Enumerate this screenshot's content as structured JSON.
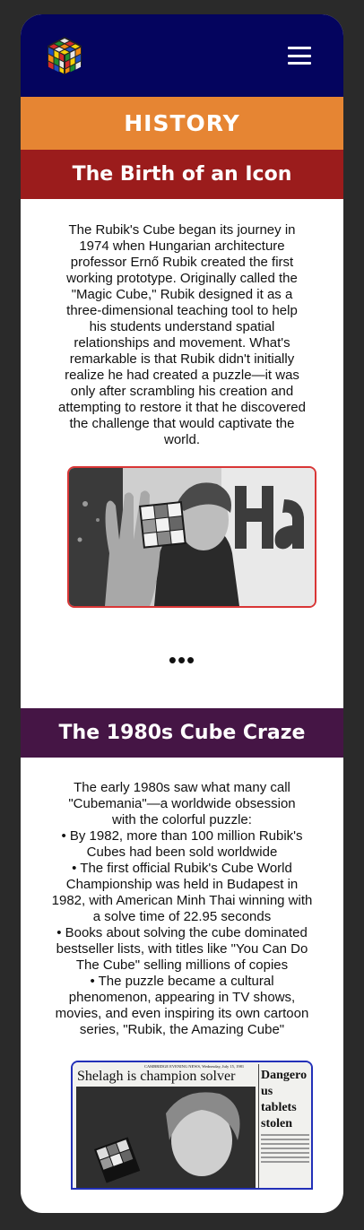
{
  "header": {
    "logo_icon": "rubiks-cube-logo",
    "menu_icon": "hamburger-menu-icon",
    "colors": {
      "background": "#04045e"
    }
  },
  "page": {
    "title": "HISTORY",
    "accent": "#e68533"
  },
  "sections": [
    {
      "heading": "The Birth of an Icon",
      "color": "#9b1c1c",
      "body": "The Rubik's Cube began its journey in 1974 when Hungarian architecture professor Ernő Rubik created the first working prototype. Originally called the \"Magic Cube,\" Rubik designed it as a three-dimensional teaching tool to help his students understand spatial relationships and movement. What's remarkable is that Rubik didn't initially realize he had created a puzzle—it was only after scrambling his creation and attempting to restore it that he discovered the challenge that would captivate the world.",
      "more": "•••"
    },
    {
      "heading": "The 1980s Cube Craze",
      "color": "#451545",
      "intro": "The early 1980s saw what many call \"Cubemania\"—a worldwide obsession with the colorful puzzle:",
      "facts": [
        "By 1982, more than 100 million Rubik's Cubes had been sold worldwide",
        "The first official Rubik's Cube World Championship was held in Budapest in 1982, with American Minh Thai winning with a solve time of 22.95 seconds",
        "Books about solving the cube dominated bestseller lists, with titles like \"You Can Do The Cube\" selling millions of copies",
        "The puzzle became a cultural phenomenon, appearing in TV shows, movies, and even inspiring its own cartoon series, \"Rubik, the Amazing Cube\""
      ],
      "clipping": {
        "masthead": "CAMBRIDGE EVENING NEWS, Wednesday, July 15, 1981",
        "headline": "Shelagh is champion solver",
        "side_headline": "Dangerous tablets stolen from poo"
      }
    }
  ]
}
